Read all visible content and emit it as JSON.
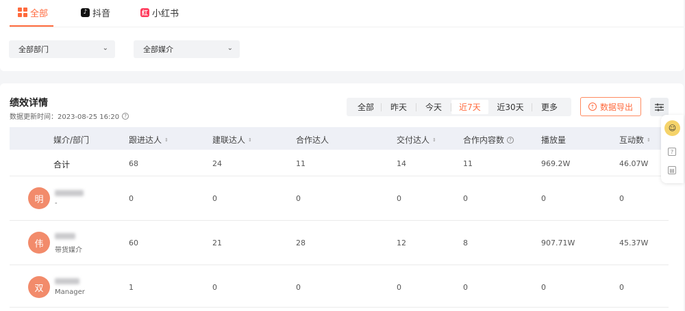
{
  "tabs": [
    {
      "label": "全部",
      "icon": "grid-icon"
    },
    {
      "label": "抖音",
      "icon": "douyin-icon"
    },
    {
      "label": "小红书",
      "icon": "xiaohongshu-icon"
    }
  ],
  "filters": {
    "department": "全部部门",
    "media": "全部媒介"
  },
  "section": {
    "title": "绩效详情",
    "updated": "数据更新时间：2023-08-25 16:20"
  },
  "ranges": [
    "全部",
    "昨天",
    "今天",
    "近7天",
    "近30天",
    "更多"
  ],
  "active_range": "近7天",
  "export_label": "数据导出",
  "columns": [
    "媒介/部门",
    "跟进达人",
    "建联达人",
    "合作达人",
    "交付达人",
    "合作内容数",
    "播放量",
    "互动数"
  ],
  "total": {
    "label": "合计",
    "values": [
      "68",
      "24",
      "11",
      "14",
      "11",
      "969.2W",
      "46.07W"
    ]
  },
  "rows": [
    {
      "avatar": "明",
      "sub": "-",
      "values": [
        "0",
        "0",
        "0",
        "0",
        "0",
        "0",
        "0"
      ]
    },
    {
      "avatar": "伟",
      "sub": "带货媒介",
      "values": [
        "60",
        "21",
        "28",
        "12",
        "8",
        "907.71W",
        "45.37W"
      ]
    },
    {
      "avatar": "双",
      "sub": "Manager",
      "values": [
        "1",
        "0",
        "0",
        "0",
        "0",
        "0",
        "0"
      ]
    }
  ],
  "colors": {
    "accent": "#ff6a3d",
    "avatar": "#f28b6b"
  }
}
